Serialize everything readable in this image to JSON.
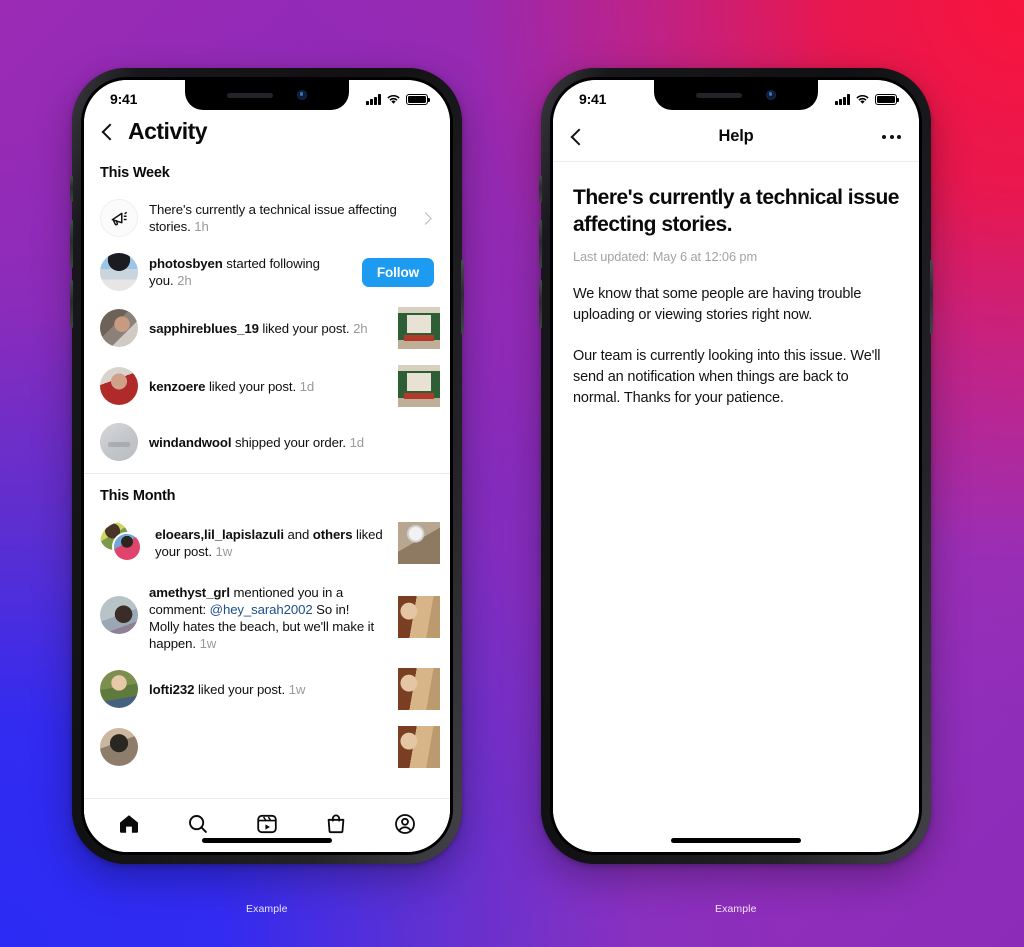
{
  "background": {
    "gradient_top_left": "#9b2bb5",
    "gradient_top_right": "#f8143c",
    "gradient_bottom_left": "#2b2bf5",
    "gradient_bottom_right": "#8b2bb8"
  },
  "captions": {
    "left": "Example",
    "right": "Example"
  },
  "left_phone": {
    "status_bar": {
      "time": "9:41",
      "cellular": "signal-bars",
      "wifi": "wifi-icon",
      "battery": "battery-full-icon"
    },
    "nav": {
      "back": "back-chevron",
      "title": "Activity"
    },
    "sections": [
      {
        "heading": "This Week",
        "items": [
          {
            "type": "announcement",
            "icon": "megaphone-icon",
            "text": "There's currently a technical issue affecting stories.",
            "time": "1h",
            "accessory": "chevron-right"
          },
          {
            "type": "follow",
            "avatar": "img-photosbyen",
            "user": "photosbyen",
            "text": " started following you.",
            "time": "2h",
            "button": "Follow"
          },
          {
            "type": "like",
            "avatar": "img-sapphire",
            "user": "sapphireblues_19",
            "text": " liked your post.",
            "time": "2h",
            "thumb": "th-storefront"
          },
          {
            "type": "like",
            "avatar": "img-kenzoere",
            "user": "kenzoere",
            "text": " liked your post.",
            "time": "1d",
            "thumb": "th-storefront"
          },
          {
            "type": "order",
            "avatar": "img-windandwool",
            "user": "windandwool",
            "text": " shipped your order.",
            "time": "1d"
          }
        ]
      },
      {
        "heading": "This Month",
        "items": [
          {
            "type": "group-like",
            "avatar": "img-eloears",
            "avatar2": "img-lapis",
            "user": "eloears,lil_lapislazuli",
            "mid": " and ",
            "user2": "others",
            "text": " liked your post.",
            "time": "1w",
            "thumb": "th-ceiling"
          },
          {
            "type": "mention",
            "avatar": "img-amethyst",
            "user": "amethyst_grl",
            "text": " mentioned you in a comment: ",
            "mention": "@hey_sarah2002",
            "text2": " So in! Molly hates the beach, but we'll make it happen.",
            "time": "1w",
            "thumb": "th-beach"
          },
          {
            "type": "like",
            "avatar": "img-lofti",
            "user": "lofti232",
            "text": " liked your post.",
            "time": "1w",
            "thumb": "th-beach"
          },
          {
            "type": "partial",
            "avatar": "img-partial",
            "thumb": "th-beach"
          }
        ]
      }
    ],
    "tabbar": [
      {
        "name": "home-icon",
        "label": "Home"
      },
      {
        "name": "search-icon",
        "label": "Search"
      },
      {
        "name": "reels-icon",
        "label": "Reels"
      },
      {
        "name": "shop-icon",
        "label": "Shop"
      },
      {
        "name": "profile-icon",
        "label": "Profile"
      }
    ]
  },
  "right_phone": {
    "status_bar": {
      "time": "9:41",
      "cellular": "signal-bars",
      "wifi": "wifi-icon",
      "battery": "battery-full-icon"
    },
    "nav": {
      "back": "back-chevron",
      "title": "Help",
      "more": "more-options"
    },
    "article": {
      "title": "There's currently a technical issue affecting stories.",
      "last_updated": "Last updated: May 6 at 12:06 pm",
      "paragraphs": [
        "We know that some people are having trouble uploading or viewing stories right now.",
        "Our team is currently looking into this issue. We'll send an notification when things are back to normal. Thanks for your patience."
      ]
    }
  }
}
